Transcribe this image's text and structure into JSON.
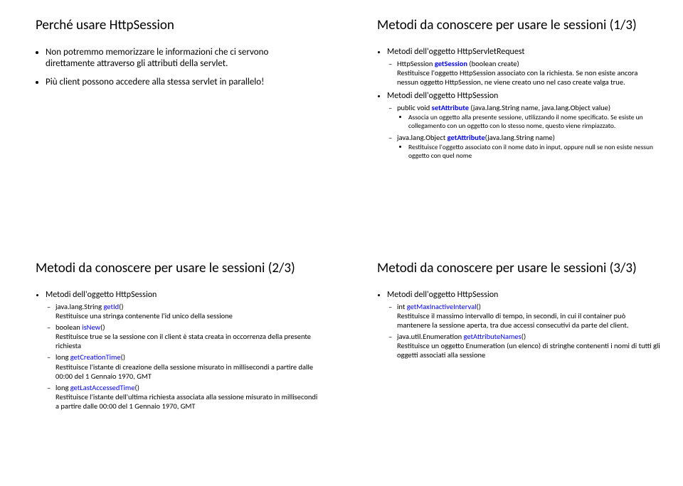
{
  "slides": {
    "s1": {
      "title": "Perché usare HttpSession",
      "b1": "Non potremmo memorizzare le informazioni che ci servono direttamente attraverso gli attributi della servlet.",
      "b2": "Più client possono accedere alla stessa servlet in parallelo!"
    },
    "s2": {
      "title": "Metodi da conoscere per usare le sessioni (1/3)",
      "b1": "Metodi dell'oggetto HttpServletRequest",
      "b1a_pre": "HttpSession ",
      "b1a_link": "getSession",
      "b1a_post": " (boolean create)",
      "b1a_desc": "Restituisce l'oggetto HttpSession associato con la richiesta. Se non esiste ancora nessun oggetto HttpSession, ne viene creato uno nel caso create valga true.",
      "b2": "Metodi dell'oggetto HttpSession",
      "b2a_pre": "public void ",
      "b2a_link": "setAttribute",
      "b2a_post": " (java.lang.String name, java.lang.Object value)",
      "b2a_d1": "Associa un oggetto alla presente sessione, utilizzando il nome specificato. Se esiste un collegamento con un oggetto con lo stesso nome, questo viene rimpiazzato.",
      "b2b_pre": "java.lang.Object ",
      "b2b_link": "getAttribute",
      "b2b_post": "(java.lang.String name)",
      "b2b_d1": "Restituisce l'oggetto associato con il nome dato in input, oppure null se non esiste nessun oggetto con quel nome"
    },
    "s3": {
      "title": "Metodi da conoscere per usare le sessioni (2/3)",
      "b1": "Metodi dell'oggetto HttpSession",
      "i1_pre": "java.lang.String  ",
      "i1_link": "getId",
      "i1_post": "()",
      "i1_desc": "Restituisce una stringa contenente l'id unico della sessione",
      "i2_pre": "boolean  ",
      "i2_link": "isNew",
      "i2_post": "()",
      "i2_desc": "Restituisce true se la sessione con il client è stata creata in occorrenza della presente richiesta",
      "i3_pre": "long  ",
      "i3_link": "getCreationTime",
      "i3_post": "()",
      "i3_desc": "Restituisce l'istante di creazione della sessione misurato in millisecondi a partire dalle 00:00 del 1 Gennaio 1970, GMT",
      "i4_pre": "long ",
      "i4_link": "getLastAccessedTime",
      "i4_post": "()",
      "i4_desc": "Restituisce l'istante dell'ultima richiesta associata alla sessione misurato in millisecondi a partire dalle 00:00 del 1 Gennaio 1970, GMT"
    },
    "s4": {
      "title": "Metodi da conoscere per usare le sessioni (3/3)",
      "b1": "Metodi dell'oggetto HttpSession",
      "i1_pre": "int ",
      "i1_link": "getMaxInactiveInterval",
      "i1_post": "()",
      "i1_desc": "Restituisce il massimo intervallo di tempo, in secondi, in cui il container può mantenere la sessione aperta, tra due accessi consecutivi da parte del client.",
      "i2_pre": "java.util.Enumeration ",
      "i2_link": "getAttributeNames",
      "i2_post": "()",
      "i2_desc": "Restituisce un oggetto Enumeration (un elenco) di stringhe contenenti i nomi di tutti gli oggetti associati alla sessione"
    }
  }
}
